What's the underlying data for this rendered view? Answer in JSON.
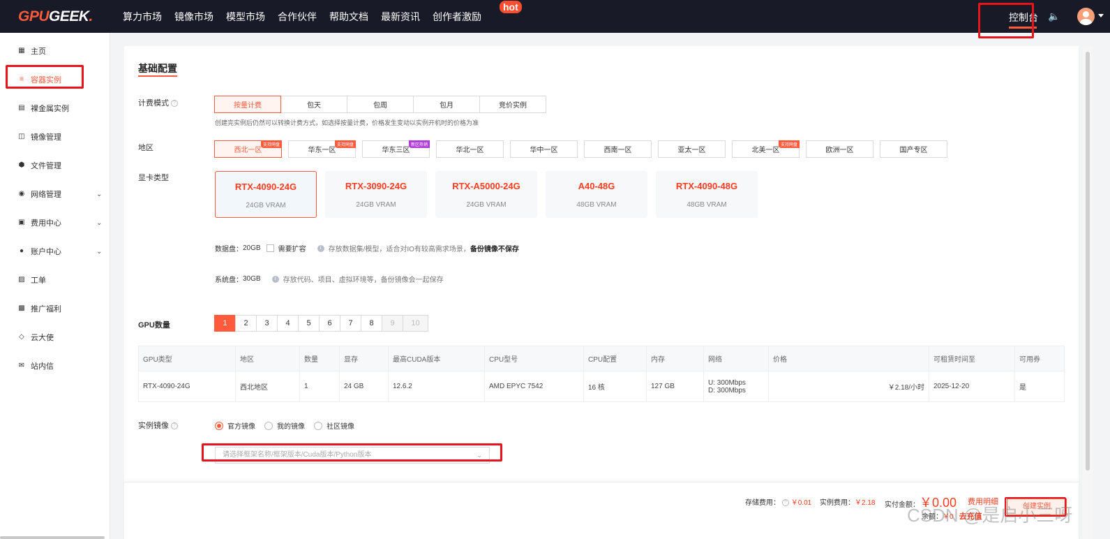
{
  "topbar": {
    "logo_accent": "GPU",
    "logo_rest": "GEEK",
    "logo_dot": ".",
    "nav": [
      "算力市场",
      "镜像市场",
      "模型市场",
      "合作伙伴",
      "帮助文档",
      "最新资讯",
      "创作者激励"
    ],
    "hot_badge": "hot",
    "console": "控制台"
  },
  "sidebar": {
    "items": [
      {
        "label": "主页",
        "icon": "grid-icon"
      },
      {
        "label": "容器实例",
        "icon": "list-icon"
      },
      {
        "label": "裸金属实例",
        "icon": "server-icon"
      },
      {
        "label": "镜像管理",
        "icon": "image-icon"
      },
      {
        "label": "文件管理",
        "icon": "hexagon-icon"
      },
      {
        "label": "网络管理",
        "icon": "globe-icon"
      },
      {
        "label": "费用中心",
        "icon": "wallet-icon"
      },
      {
        "label": "账户中心",
        "icon": "user-icon"
      },
      {
        "label": "工单",
        "icon": "clipboard-icon"
      },
      {
        "label": "推广福利",
        "icon": "gift-icon"
      },
      {
        "label": "云大使",
        "icon": "diamond-icon"
      },
      {
        "label": "站内信",
        "icon": "mail-icon"
      }
    ]
  },
  "config": {
    "title": "基础配置",
    "billing_label": "计费模式",
    "billing_options": [
      "按量计费",
      "包天",
      "包周",
      "包月",
      "竞价实例"
    ],
    "billing_hint": "创建完实例后仍然可以转换计费方式，如选择按量计费，价格发生变动以实例开机时的价格为准",
    "region_label": "地区",
    "regions": [
      {
        "name": "西北一区",
        "tag": "支持网盘"
      },
      {
        "name": "华东一区",
        "tag": "支持网盘"
      },
      {
        "name": "华东三区",
        "tag": "新区热销"
      },
      {
        "name": "华北一区",
        "tag": ""
      },
      {
        "name": "华中一区",
        "tag": ""
      },
      {
        "name": "西南一区",
        "tag": ""
      },
      {
        "name": "亚太一区",
        "tag": ""
      },
      {
        "name": "北美一区",
        "tag": "支持网盘"
      },
      {
        "name": "欧洲一区",
        "tag": ""
      },
      {
        "name": "国产专区",
        "tag": ""
      }
    ],
    "gpu_label": "显卡类型",
    "gpus": [
      {
        "name": "RTX-4090-24G",
        "vram": "24GB VRAM"
      },
      {
        "name": "RTX-3090-24G",
        "vram": "24GB VRAM"
      },
      {
        "name": "RTX-A5000-24G",
        "vram": "24GB VRAM"
      },
      {
        "name": "A40-48G",
        "vram": "48GB VRAM"
      },
      {
        "name": "RTX-4090-48G",
        "vram": "48GB VRAM"
      }
    ],
    "data_disk": {
      "label": "数据盘：",
      "value": "20GB",
      "expand": "需要扩容",
      "desc": "存放数据集/模型，适合对IO有较高需求场景，",
      "bold": "备份镜像不保存"
    },
    "system_disk": {
      "label": "系统盘：",
      "value": "30GB",
      "desc": "存放代码、项目、虚拟环境等，备份镜像会一起保存"
    },
    "gpu_count_label": "GPU数量",
    "gpu_counts": [
      "1",
      "2",
      "3",
      "4",
      "5",
      "6",
      "7",
      "8",
      "9",
      "10"
    ],
    "table": {
      "headers": [
        "GPU类型",
        "地区",
        "数量",
        "显存",
        "最高CUDA版本",
        "CPU型号",
        "CPU配置",
        "内存",
        "网络",
        "价格",
        "可租赁时间至",
        "可用券"
      ],
      "row": {
        "gpu": "RTX-4090-24G",
        "region": "西北地区",
        "count": "1",
        "vram": "24 GB",
        "cuda": "12.6.2",
        "cpu": "AMD EPYC 7542",
        "cpu_cfg": "16 核",
        "mem": "127 GB",
        "net_up": "U: 300Mbps",
        "net_down": "D: 300Mbps",
        "price": "￥2.18",
        "price_unit": "/小时",
        "until": "2025-12-20",
        "coupon": "是"
      }
    },
    "image_label": "实例镜像",
    "image_options": [
      "官方镜像",
      "我的镜像",
      "社区镜像"
    ],
    "image_placeholder": "请选择框架名称/框架版本/Cuda版本/Python版本"
  },
  "footer": {
    "storage_label": "存储费用：",
    "storage_value": "￥0.01",
    "instance_label": "实例费用：",
    "instance_value": "￥2.18",
    "total_label": "实付金额：",
    "total_value": "￥0.00",
    "detail": "费用明细",
    "create": "创建实例",
    "balance_label": "余额：",
    "balance_value": "￥0",
    "recharge": "去充值"
  },
  "watermark": "CSDN @是启小三呀",
  "colors": {
    "accent": "#ff5a3c",
    "topbar": "#181b27",
    "highlight_box": "#e8141b"
  }
}
